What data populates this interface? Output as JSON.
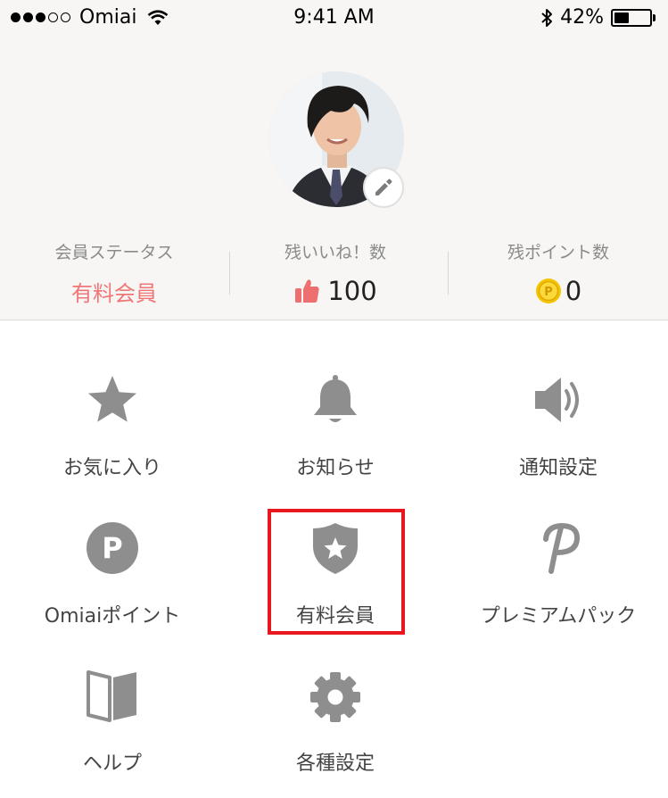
{
  "status_bar": {
    "carrier": "Omiai",
    "time": "9:41 AM",
    "battery_percent": "42%",
    "battery_level": 0.42,
    "signal_full": 3,
    "signal_empty": 2
  },
  "profile": {
    "avatar_alt": "profile photo",
    "stats": [
      {
        "label": "会員ステータス",
        "value": "有料会員"
      },
      {
        "label": "残いいね！数",
        "value": "100",
        "icon": "thumbs-up-icon"
      },
      {
        "label": "残ポイント数",
        "value": "0",
        "icon": "coin-icon"
      }
    ]
  },
  "menu": [
    {
      "label": "お気に入り",
      "icon": "star-icon"
    },
    {
      "label": "お知らせ",
      "icon": "bell-icon"
    },
    {
      "label": "通知設定",
      "icon": "speaker-icon"
    },
    {
      "label": "Omiaiポイント",
      "icon": "p-circle-icon"
    },
    {
      "label": "有料会員",
      "icon": "shield-star-icon"
    },
    {
      "label": "プレミアムパック",
      "icon": "script-p-icon"
    },
    {
      "label": "ヘルプ",
      "icon": "book-icon"
    },
    {
      "label": "各種設定",
      "icon": "gear-icon"
    }
  ],
  "colors": {
    "accent_pink": "#f07777",
    "highlight_red": "#e8161f",
    "icon_gray": "#8e8e8e",
    "coin_yellow": "#f5c400"
  }
}
